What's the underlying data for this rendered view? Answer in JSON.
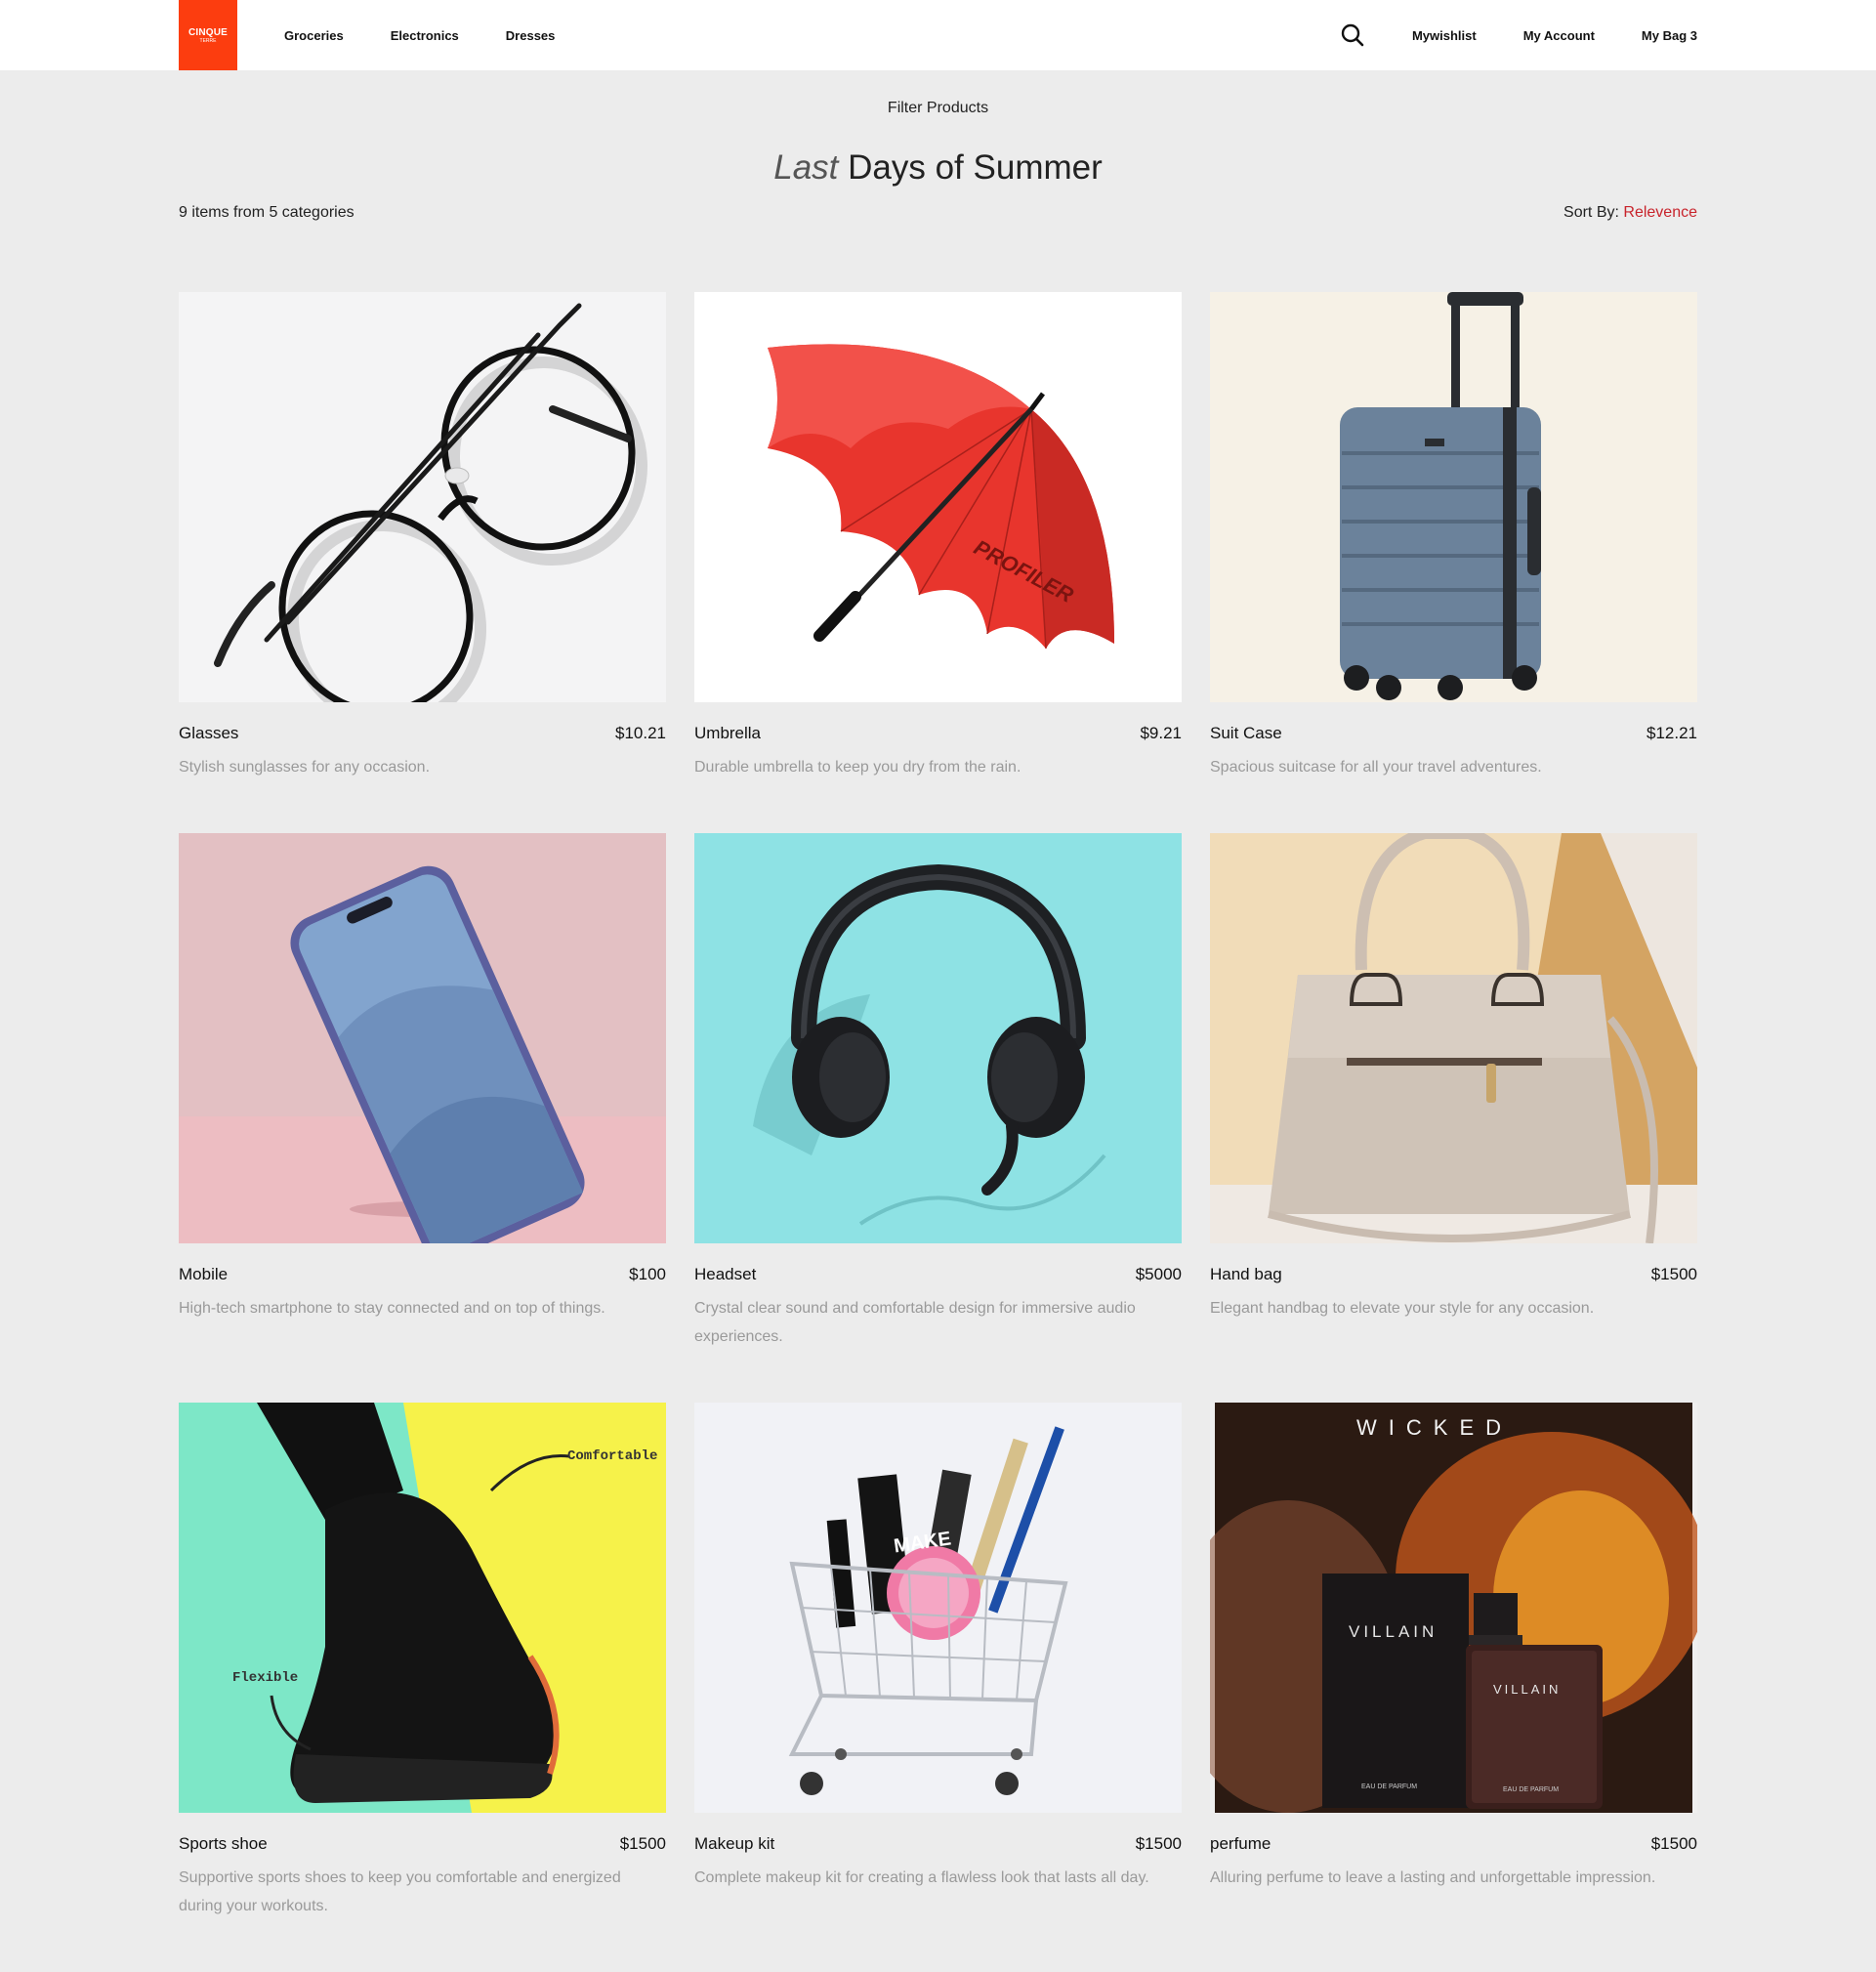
{
  "brand": {
    "logo_line1": "CINQUE",
    "logo_line2": "TERRE"
  },
  "nav": {
    "left": [
      "Groceries",
      "Electronics",
      "Dresses"
    ],
    "wishlist": "Mywishlist",
    "account": "My Account",
    "bag": "My Bag 3"
  },
  "filter_label": "Filter Products",
  "title": {
    "accent": "Last",
    "rest": "Days of Summer"
  },
  "summary": "9 items from 5 categories",
  "sort": {
    "label": "Sort By:",
    "value": "Relevence"
  },
  "colors": {
    "brand": "#fc3d0f",
    "sort_accent": "#c8242c",
    "background": "#ececec"
  },
  "products": [
    {
      "name": "Glasses",
      "price": "$10.21",
      "desc": "Stylish sunglasses for any occasion.",
      "image": "glasses"
    },
    {
      "name": "Umbrella",
      "price": "$9.21",
      "desc": "Durable umbrella to keep you dry from the rain.",
      "image": "umbrella",
      "image_text": "PROFILER"
    },
    {
      "name": "Suit Case",
      "price": "$12.21",
      "desc": "Spacious suitcase for all your travel adventures.",
      "image": "suitcase"
    },
    {
      "name": "Mobile",
      "price": "$100",
      "desc": "High-tech smartphone to stay connected and on top of things.",
      "image": "smartphone"
    },
    {
      "name": "Headset",
      "price": "$5000",
      "desc": "Crystal clear sound and comfortable design for immersive audio experiences.",
      "image": "headset"
    },
    {
      "name": "Hand bag",
      "price": "$1500",
      "desc": "Elegant handbag to elevate your style for any occasion.",
      "image": "handbag"
    },
    {
      "name": "Sports shoe",
      "price": "$1500",
      "desc": "Supportive sports shoes to keep you comfortable and energized during your workouts.",
      "image": "sports-shoe",
      "image_labels": [
        "Comfortable",
        "Flexible"
      ]
    },
    {
      "name": "Makeup kit",
      "price": "$1500",
      "desc": "Complete makeup kit for creating a flawless look that lasts all day.",
      "image": "makeup-cart",
      "image_text": "MAKE"
    },
    {
      "name": "perfume",
      "price": "$1500",
      "desc": "Alluring perfume to leave a lasting and unforgettable impression.",
      "image": "perfume",
      "image_texts": [
        "WICKED",
        "VILLAIN",
        "VILLAIN",
        "EAU DE PARFUM",
        "EAU DE PARFUM"
      ]
    }
  ]
}
